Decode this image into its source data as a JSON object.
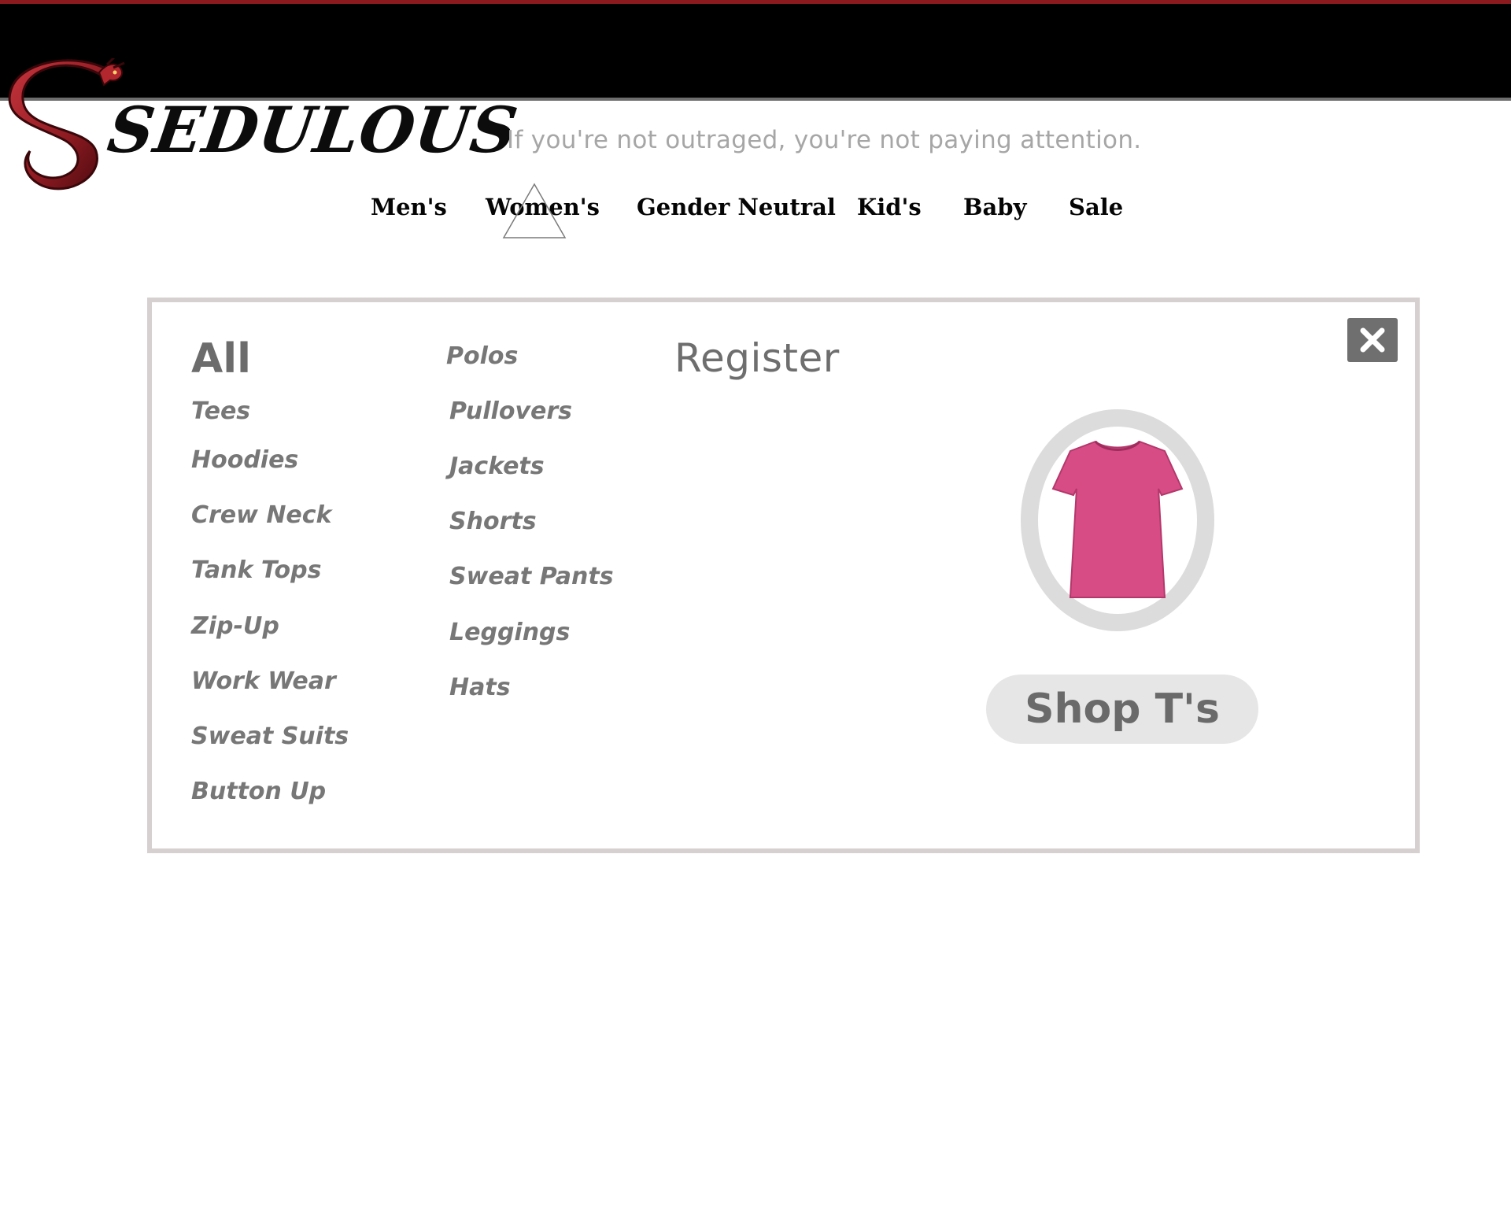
{
  "brand": {
    "name": "SEDULOUS",
    "logo_icon": "dragon-icon",
    "accent": "#8b1a1f"
  },
  "tagline": "If you're not outraged, you're not paying attention.",
  "nav": {
    "items": [
      {
        "label": "Men's"
      },
      {
        "label": "Women's"
      },
      {
        "label": "Gender Neutral"
      },
      {
        "label": "Kid's"
      },
      {
        "label": "Baby"
      },
      {
        "label": "Sale"
      }
    ],
    "active": "Women's"
  },
  "menu": {
    "all_label": "All",
    "column1": [
      "Tees",
      "Hoodies",
      "Crew Neck",
      "Tank Tops",
      "Zip-Up",
      "Work Wear",
      "Sweat Suits",
      "Button Up"
    ],
    "column2": [
      "Polos",
      "Pullovers",
      "Jackets",
      "Shorts",
      "Sweat Pants",
      "Leggings",
      "Hats"
    ],
    "register_label": "Register",
    "close_icon": "close-icon",
    "feature": {
      "image_icon": "pink-tshirt-icon",
      "button_label": "Shop T's",
      "shirt_color": "#d84c86"
    }
  }
}
